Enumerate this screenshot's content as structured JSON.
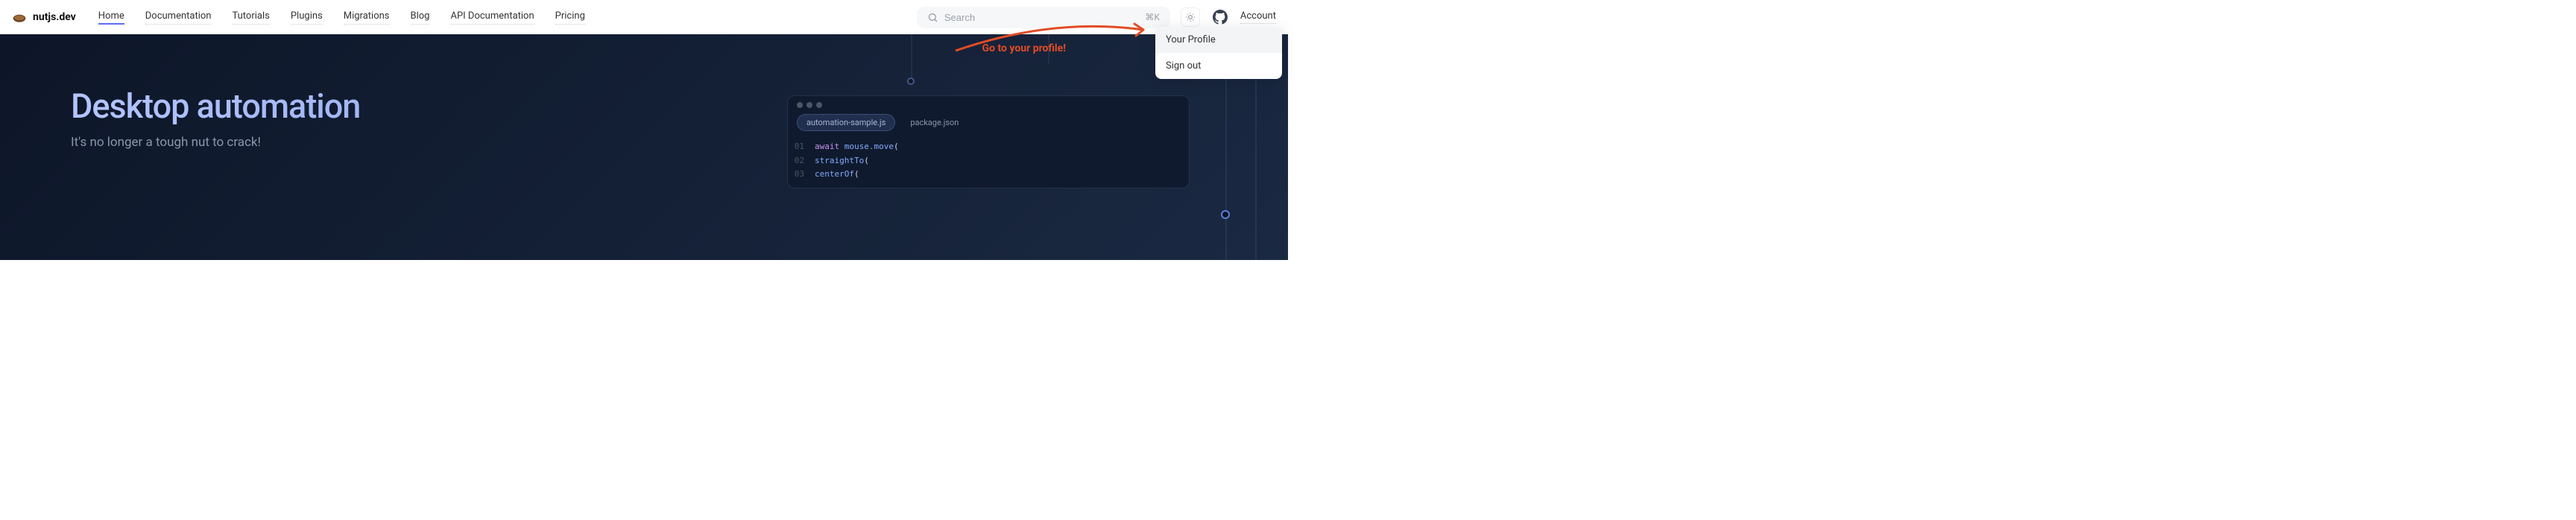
{
  "brand": {
    "name": "nutjs.dev"
  },
  "nav": {
    "items": [
      {
        "label": "Home",
        "active": true
      },
      {
        "label": "Documentation"
      },
      {
        "label": "Tutorials"
      },
      {
        "label": "Plugins"
      },
      {
        "label": "Migrations"
      },
      {
        "label": "Blog"
      },
      {
        "label": "API Documentation"
      },
      {
        "label": "Pricing"
      }
    ]
  },
  "search": {
    "placeholder": "Search",
    "shortcut": "⌘K"
  },
  "account": {
    "label": "Account"
  },
  "dropdown": {
    "items": [
      {
        "label": "Your Profile"
      },
      {
        "label": "Sign out"
      }
    ]
  },
  "annotation": {
    "text": "Go to your profile!"
  },
  "hero": {
    "title": "Desktop automation",
    "subtitle": "It's no longer a tough nut to crack!"
  },
  "code": {
    "tabs": [
      {
        "label": "automation-sample.js",
        "active": true
      },
      {
        "label": "package.json"
      }
    ],
    "lines": [
      {
        "num": "01",
        "tokens": [
          {
            "t": "await",
            "c": "kw"
          },
          {
            "t": " "
          },
          {
            "t": "mouse",
            "c": "fn"
          },
          {
            "t": ".",
            "c": "dot"
          },
          {
            "t": "move",
            "c": "fn"
          },
          {
            "t": "(",
            "c": "paren"
          }
        ]
      },
      {
        "num": "02",
        "tokens": [
          {
            "t": "  "
          },
          {
            "t": "straightTo",
            "c": "fn"
          },
          {
            "t": "(",
            "c": "paren"
          }
        ]
      },
      {
        "num": "03",
        "tokens": [
          {
            "t": "    "
          },
          {
            "t": "centerOf",
            "c": "fn"
          },
          {
            "t": "(",
            "c": "paren"
          }
        ]
      }
    ]
  }
}
